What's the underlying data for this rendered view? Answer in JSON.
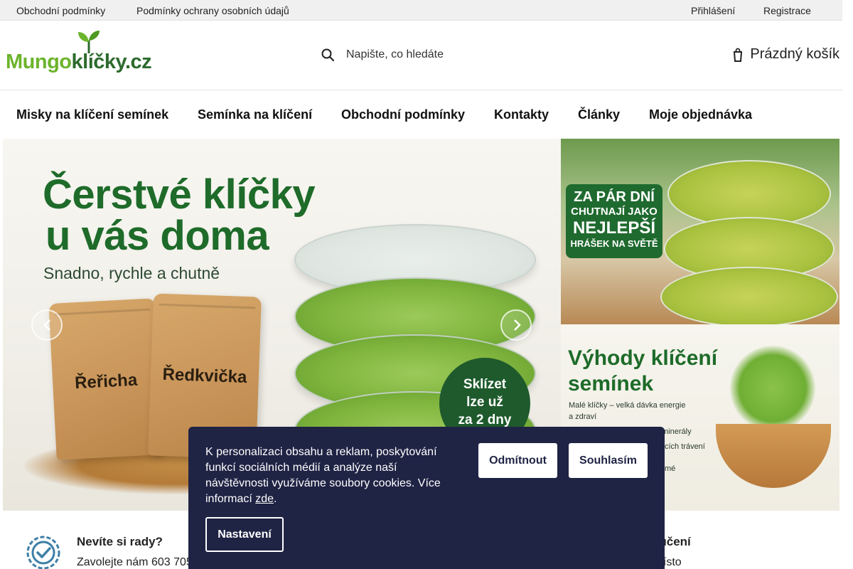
{
  "topbar": {
    "links": [
      "Obchodní podmínky",
      "Podmínky ochrany osobních údajů"
    ],
    "login": "Přihlášení",
    "register": "Registrace"
  },
  "header": {
    "logo": {
      "part1": "Mungo",
      "part2": "klíčky.cz"
    },
    "search": {
      "placeholder": "Napište, co hledáte",
      "icon": "search-icon"
    },
    "cart": {
      "label": "Prázdný košík",
      "icon": "cart-icon"
    }
  },
  "nav": {
    "items": [
      "Misky na klíčení semínek",
      "Semínka na klíčení",
      "Obchodní podmínky",
      "Kontakty",
      "Články",
      "Moje objednávka"
    ]
  },
  "hero": {
    "title_line1": "Čerstvé klíčky",
    "title_line2": "u vás doma",
    "subtitle": "Snadno, rychle a chutně",
    "bag1": "Řeřicha",
    "bag2": "Ředkvička",
    "badge": [
      "Sklízet",
      "lze už",
      "za 2 dny"
    ]
  },
  "side_banner_1": {
    "lines": [
      "ZA PÁR DNÍ",
      "CHUTNAJÍ JAKO",
      "NEJLEPŠÍ",
      "HRÁŠEK NA SVĚTĚ"
    ]
  },
  "side_banner_2": {
    "title_line1": "Výhody klíčení",
    "title_line2": "semínek",
    "text_line1": "Malé klíčky – velká dávka energie",
    "text_line2": "a zdraví",
    "frag1": "minerály",
    "frag2": "cích trávení",
    "frag3": "mé"
  },
  "info": {
    "title1": "Nevíte si rady?",
    "text1": "Zavolejte nám 603 705",
    "title2": "doručení",
    "text2": "liv místo"
  },
  "cookie": {
    "text": "K personalizaci obsahu a reklam, poskytování funkcí sociálních médií a analýze naší návštěvnosti využíváme soubory cookies. Více informací ",
    "link": "zde",
    "after": ".",
    "decline": "Odmítnout",
    "accept": "Souhlasím",
    "settings": "Nastavení"
  },
  "colors": {
    "brand_green": "#6cb42c",
    "brand_dark_green": "#1e6b2a",
    "cookie_bg": "#1f2344"
  }
}
